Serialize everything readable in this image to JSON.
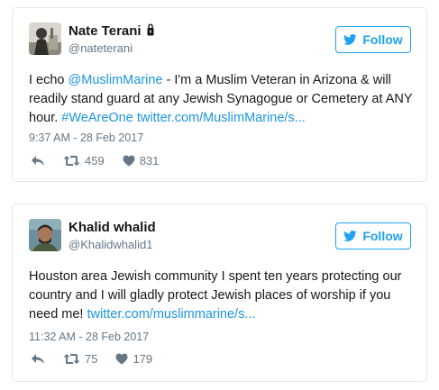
{
  "tweets": [
    {
      "name": "Nate Terani",
      "handle": "@nateterani",
      "follow_label": "Follow",
      "text": {
        "t1": "I echo ",
        "mention": "@MuslimMarine",
        "t2": " - I'm a Muslim Veteran in Arizona & will readily stand guard at any Jewish Synagogue or Cemetery at ANY hour. ",
        "hashtag": "#WeAreOne",
        "link": "twitter.com/MuslimMarine/s..."
      },
      "timestamp": "9:37 AM - 28 Feb 2017",
      "retweets": "459",
      "likes": "831"
    },
    {
      "name": "Khalid whalid",
      "handle": "@Khalidwhalid1",
      "follow_label": "Follow",
      "text": {
        "t1": "Houston area Jewish community I spent ten years protecting our country and I will gladly protect Jewish places of worship if you need me! ",
        "link": "twitter.com/muslimmarine/s..."
      },
      "timestamp": "11:32 AM - 28 Feb 2017",
      "retweets": "75",
      "likes": "179"
    }
  ],
  "colors": {
    "accent": "#1da1f2",
    "link": "#1b95e0",
    "text": "#14171a",
    "secondary": "#657786",
    "border": "#e1e8ed"
  }
}
